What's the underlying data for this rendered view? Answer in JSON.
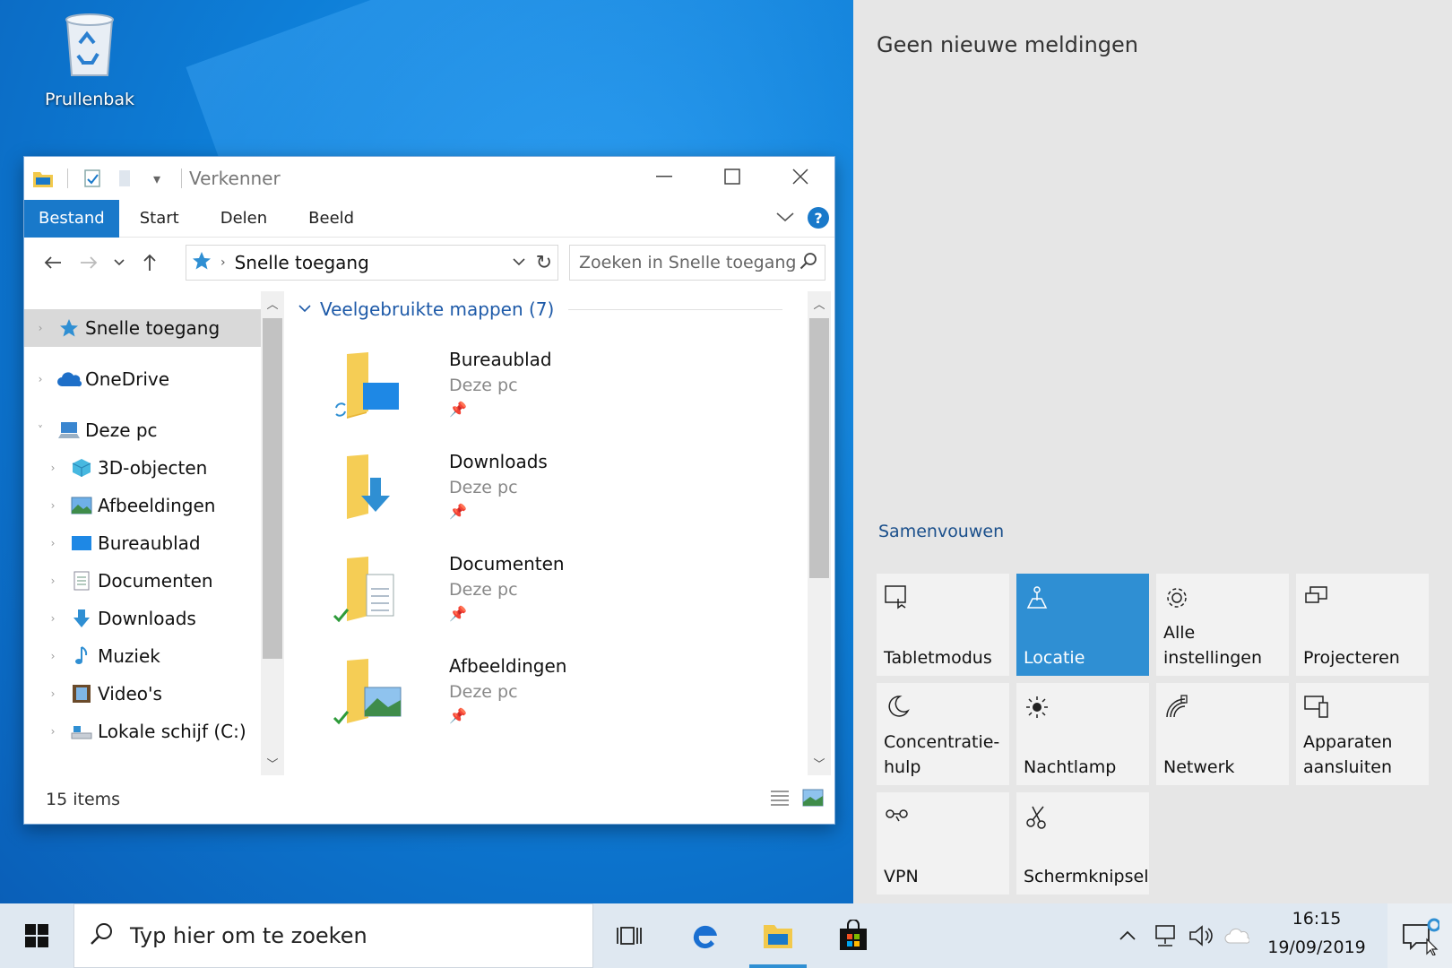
{
  "desktop": {
    "icon_label": "Prullenbak"
  },
  "explorer": {
    "title": "Verkenner",
    "ribbon_tabs": [
      "Bestand",
      "Start",
      "Delen",
      "Beeld"
    ],
    "address": "Snelle toegang",
    "search_placeholder": "Zoeken in Snelle toegang",
    "nav_items": [
      "Snelle toegang",
      "OneDrive",
      "Deze pc",
      "3D-objecten",
      "Afbeeldingen",
      "Bureaublad",
      "Documenten",
      "Downloads",
      "Muziek",
      "Video's",
      "Lokale schijf (C:)"
    ],
    "group_title": "Veelgebruikte mappen (7)",
    "folders": [
      {
        "name": "Bureaublad",
        "location": "Deze pc"
      },
      {
        "name": "Downloads",
        "location": "Deze pc"
      },
      {
        "name": "Documenten",
        "location": "Deze pc"
      },
      {
        "name": "Afbeeldingen",
        "location": "Deze pc"
      }
    ],
    "status_count": "15 items"
  },
  "action_center": {
    "title": "Geen nieuwe meldingen",
    "collapse_label": "Samenvouwen",
    "tiles": [
      {
        "label": "Tabletmodus",
        "icon": "tablet-icon",
        "active": false
      },
      {
        "label": "Locatie",
        "icon": "location-icon",
        "active": true
      },
      {
        "label": "Alle instellingen",
        "icon": "gear-icon",
        "active": false
      },
      {
        "label": "Projecteren",
        "icon": "project-icon",
        "active": false
      },
      {
        "label": "Concentratie-hulp",
        "icon": "moon-icon",
        "active": false
      },
      {
        "label": "Nachtlamp",
        "icon": "brightness-icon",
        "active": false
      },
      {
        "label": "Netwerk",
        "icon": "network-icon",
        "active": false
      },
      {
        "label": "Apparaten aansluiten",
        "icon": "connect-icon",
        "active": false
      },
      {
        "label": "VPN",
        "icon": "vpn-icon",
        "active": false
      },
      {
        "label": "Schermknipsel",
        "icon": "snip-icon",
        "active": false
      }
    ],
    "accent_color": "#2f8fd3"
  },
  "taskbar": {
    "search_placeholder": "Typ hier om te zoeken",
    "time": "16:15",
    "date": "19/09/2019"
  }
}
